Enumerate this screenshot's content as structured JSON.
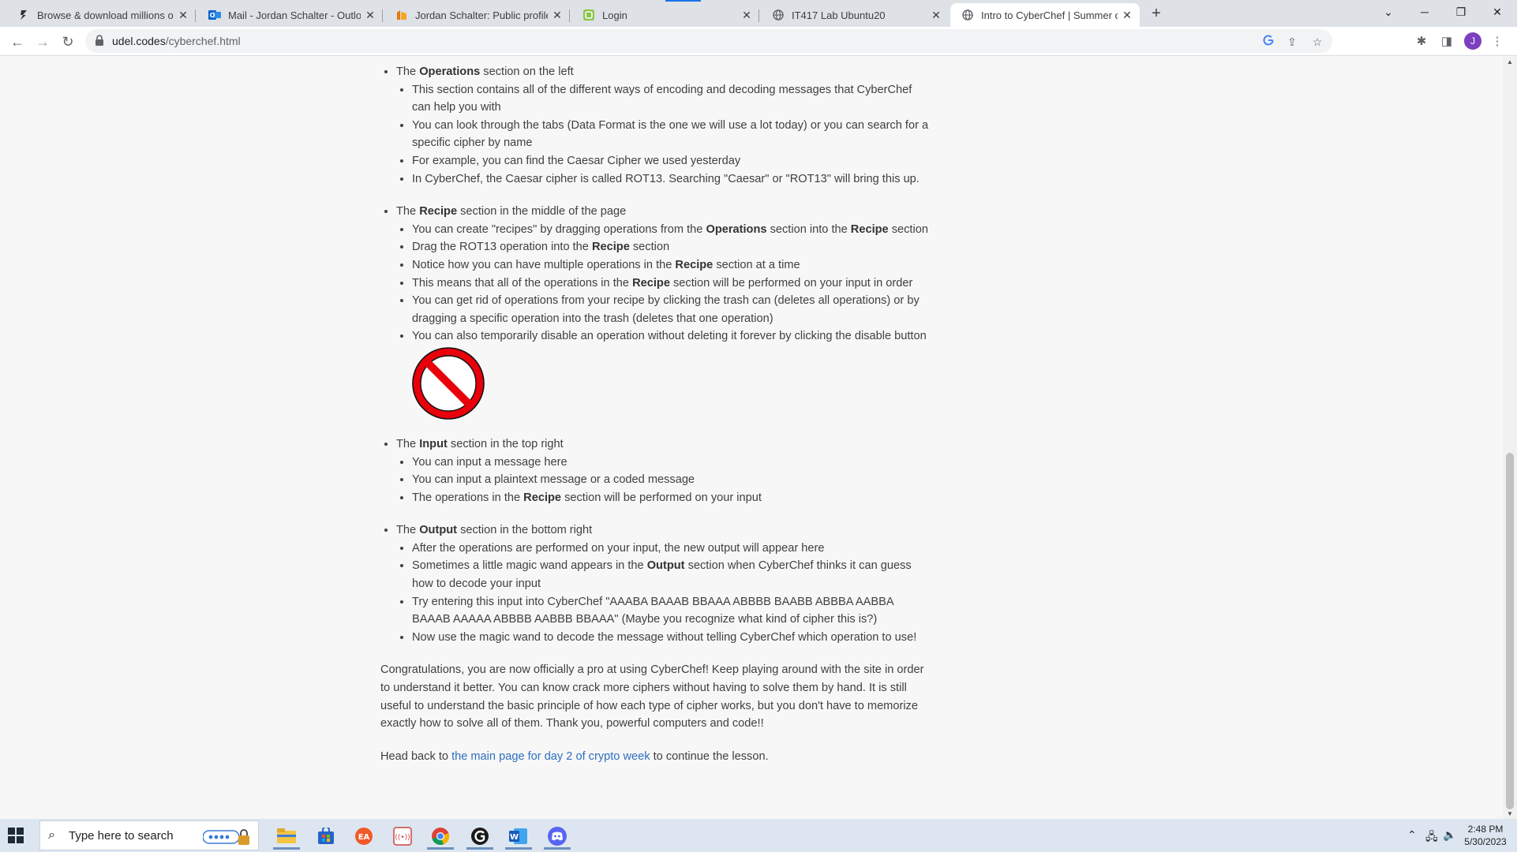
{
  "browser": {
    "tabs": [
      {
        "title": "Browse & download millions of p",
        "icon": "site-icon"
      },
      {
        "title": "Mail - Jordan Schalter - Outlook",
        "icon": "outlook-icon"
      },
      {
        "title": "Jordan Schalter: Public profile",
        "icon": "profile-icon"
      },
      {
        "title": "Login",
        "icon": "login-icon"
      },
      {
        "title": "IT417 Lab Ubuntu20",
        "icon": "globe-icon"
      },
      {
        "title": "Intro to CyberChef | Summer of C",
        "icon": "globe-icon"
      }
    ],
    "address": {
      "host": "udel.codes",
      "path": "/cyberchef.html"
    },
    "avatar_letter": "J",
    "accent": "#1a73e8"
  },
  "content": {
    "operations": {
      "pre": "The ",
      "bold": "Operations",
      "post": " section on the left",
      "items": [
        "This section contains all of the different ways of encoding and decoding messages that CyberChef can help you with",
        "You can look through the tabs (Data Format is the one we will use a lot today) or you can search for a specific cipher by name",
        "For example, you can find the Caesar Cipher we used yesterday",
        "In CyberChef, the Caesar cipher is called ROT13. Searching \"Caesar\" or \"ROT13\" will bring this up."
      ]
    },
    "recipe": {
      "pre": "The ",
      "bold": "Recipe",
      "post": " section in the middle of the page",
      "item1": {
        "a": "You can create \"recipes\" by dragging operations from the ",
        "b": "Operations",
        "c": " section into the ",
        "d": "Recipe",
        "e": " section"
      },
      "item2": {
        "a": "Drag the ROT13 operation into the ",
        "b": "Recipe",
        "c": " section"
      },
      "item3": {
        "a": "Notice how you can have multiple operations in the ",
        "b": "Recipe",
        "c": " section at a time"
      },
      "item4": {
        "a": "This means that all of the operations in the ",
        "b": "Recipe",
        "c": " section will be performed on your input in order"
      },
      "item5": "You can get rid of operations from your recipe by clicking the trash can (deletes all operations) or by dragging a specific operation into the trash (deletes that one operation)",
      "item6": "You can also temporarily disable an operation without deleting it forever by clicking the disable button",
      "disable_icon_color": "#e8000b"
    },
    "input": {
      "pre": "The ",
      "bold": "Input",
      "post": " section in the top right",
      "item1": "You can input a message here",
      "item2": "You can input a plaintext message or a coded message",
      "item3": {
        "a": "The operations in the ",
        "b": "Recipe",
        "c": " section will be performed on your input"
      }
    },
    "output": {
      "pre": "The ",
      "bold": "Output",
      "post": " section in the bottom right",
      "item1": "After the operations are performed on your input, the new output will appear here",
      "item2": {
        "a": "Sometimes a little magic wand appears in the ",
        "b": "Output",
        "c": " section when CyberChef thinks it can guess how to decode your input"
      },
      "item3": "Try entering this input into CyberChef \"AAABA BAAAB BBAAA ABBBB BAABB ABBBA AABBA BAAAB AAAAA ABBBB AABBB BBAAA\" (Maybe you recognize what kind of cipher this is?)",
      "item4": "Now use the magic wand to decode the message without telling CyberChef which operation to use!"
    },
    "congrats": "Congratulations, you are now officially a pro at using CyberChef! Keep playing around with the site in order to understand it better. You can know crack more ciphers without having to solve them by hand. It is still useful to understand the basic principle of how each type of cipher works, but you don't have to memorize exactly how to solve all of them. Thank you, powerful computers and code!!",
    "back": {
      "pre": "Head back to ",
      "link": "the main page for day 2 of crypto week",
      "post": " to continue the lesson.",
      "link_color": "#2f6fbf"
    }
  },
  "taskbar": {
    "search_placeholder": "Type here to search",
    "apps": [
      "file-explorer-icon",
      "store-icon",
      "ea-icon",
      "audio-app-icon",
      "chrome-icon",
      "github-icon",
      "word-icon",
      "discord-icon"
    ],
    "time": "2:48 PM",
    "date": "5/30/2023"
  }
}
